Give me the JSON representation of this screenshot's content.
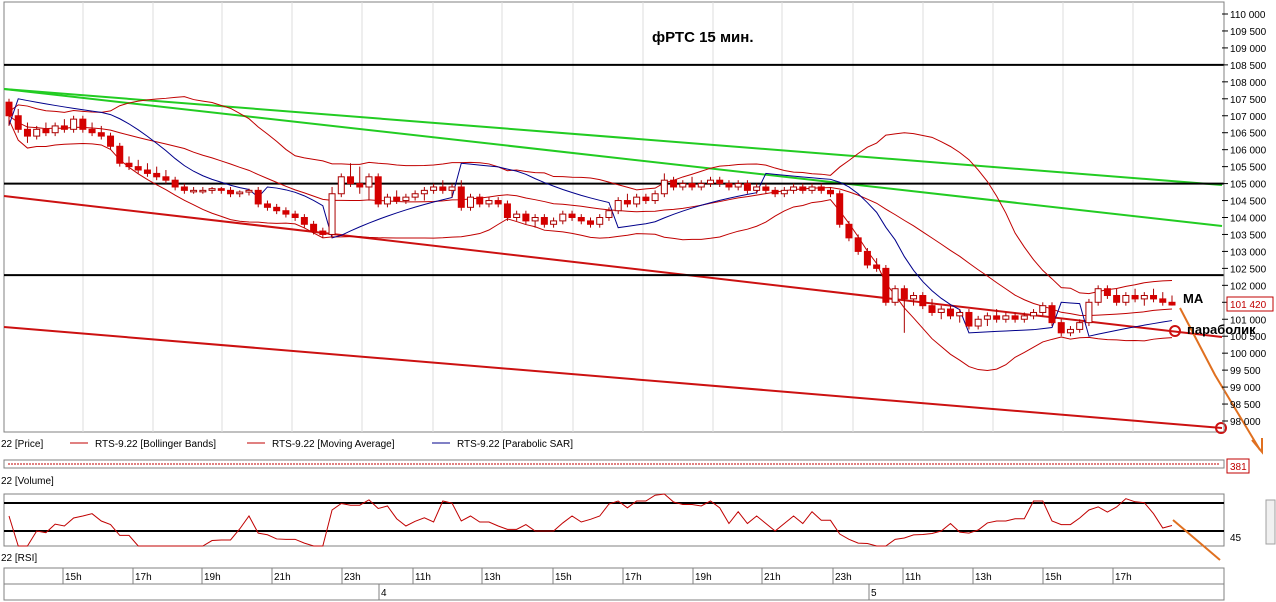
{
  "window": {
    "legend_items": [
      {
        "label": "22 [Price]",
        "color": "#000000"
      },
      {
        "label": "RTS-9.22 [Bollinger Bands]",
        "color": "#c00000"
      },
      {
        "label": "RTS-9.22 [Moving Average]",
        "color": "#c00000"
      },
      {
        "label": "RTS-9.22 [Parabolic SAR]",
        "color": "#00008b"
      }
    ],
    "volume_label": "22 [Volume]",
    "rsi_label": "22 [RSI]",
    "scroll_badge": "381"
  },
  "chart_data": {
    "type": "candlestick",
    "title": "фРТС   15 мин.",
    "price_axis": {
      "ticks": [
        110000,
        109500,
        109000,
        108500,
        108000,
        107500,
        107000,
        106500,
        106000,
        105500,
        105000,
        104500,
        104000,
        103500,
        103000,
        102500,
        102000,
        101500,
        101000,
        100500,
        100000,
        99500,
        99000,
        98500,
        98000
      ],
      "tick_labels": [
        "110 000",
        "109 500",
        "109 000",
        "108 500",
        "108 000",
        "107 500",
        "107 000",
        "106 500",
        "106 000",
        "105 500",
        "105 000",
        "104 500",
        "104 000",
        "103 500",
        "103 000",
        "102 500",
        "102 000",
        "101 500",
        "101 000",
        "100 500",
        "100 000",
        "99 500",
        "99 000",
        "98 500",
        "98 000"
      ],
      "current_price": 101420,
      "current_price_label": "101 420"
    },
    "time_axis": {
      "hour_labels": [
        "15h",
        "17h",
        "19h",
        "21h",
        "23h",
        "11h",
        "13h",
        "15h",
        "17h",
        "19h",
        "21h",
        "23h",
        "11h",
        "13h",
        "15h",
        "17h"
      ],
      "day_labels": [
        "4",
        "5"
      ]
    },
    "horizontal_levels": [
      108500,
      105000,
      102300
    ],
    "annotations": [
      "MA",
      "параболик"
    ],
    "rsi_axis": {
      "tick_label": "45"
    },
    "candles": [
      [
        107400,
        107500,
        106700,
        107000
      ],
      [
        107000,
        107200,
        106500,
        106600
      ],
      [
        106600,
        106800,
        106200,
        106400
      ],
      [
        106400,
        106700,
        106300,
        106600
      ],
      [
        106600,
        106800,
        106400,
        106500
      ],
      [
        106500,
        106800,
        106400,
        106700
      ],
      [
        106700,
        106900,
        106500,
        106600
      ],
      [
        106600,
        107000,
        106500,
        106900
      ],
      [
        106900,
        107000,
        106500,
        106600
      ],
      [
        106600,
        106800,
        106400,
        106500
      ],
      [
        106500,
        106700,
        106300,
        106400
      ],
      [
        106400,
        106500,
        106000,
        106100
      ],
      [
        106100,
        106200,
        105500,
        105600
      ],
      [
        105600,
        105800,
        105400,
        105500
      ],
      [
        105500,
        105700,
        105300,
        105400
      ],
      [
        105400,
        105600,
        105200,
        105300
      ],
      [
        105300,
        105500,
        105100,
        105200
      ],
      [
        105200,
        105400,
        105000,
        105100
      ],
      [
        105100,
        105200,
        104800,
        104900
      ],
      [
        104900,
        105000,
        104700,
        104800
      ],
      [
        104800,
        104900,
        104700,
        104800
      ],
      [
        104800,
        104900,
        104700,
        104800
      ],
      [
        104800,
        104900,
        104700,
        104850
      ],
      [
        104850,
        104900,
        104700,
        104800
      ],
      [
        104800,
        104900,
        104600,
        104700
      ],
      [
        104700,
        104800,
        104600,
        104750
      ],
      [
        104750,
        104850,
        104650,
        104800
      ],
      [
        104800,
        104900,
        104300,
        104400
      ],
      [
        104400,
        104500,
        104200,
        104300
      ],
      [
        104300,
        104400,
        104100,
        104200
      ],
      [
        104200,
        104300,
        104000,
        104100
      ],
      [
        104100,
        104200,
        103900,
        104000
      ],
      [
        104000,
        104100,
        103700,
        103800
      ],
      [
        103800,
        103900,
        103500,
        103600
      ],
      [
        103600,
        103700,
        103400,
        103500
      ],
      [
        103500,
        104900,
        103400,
        104700
      ],
      [
        104700,
        105300,
        104600,
        105200
      ],
      [
        105200,
        105600,
        104900,
        105000
      ],
      [
        105000,
        105500,
        104700,
        104900
      ],
      [
        104900,
        105300,
        104500,
        105200
      ],
      [
        105200,
        105300,
        104300,
        104400
      ],
      [
        104400,
        104700,
        104300,
        104600
      ],
      [
        104600,
        104800,
        104400,
        104500
      ],
      [
        104500,
        104700,
        104400,
        104600
      ],
      [
        104600,
        104800,
        104500,
        104700
      ],
      [
        104700,
        104900,
        104500,
        104800
      ],
      [
        104800,
        105000,
        104700,
        104900
      ],
      [
        104900,
        105100,
        104700,
        104800
      ],
      [
        104800,
        105000,
        104600,
        104900
      ],
      [
        104900,
        105100,
        104200,
        104300
      ],
      [
        104300,
        104700,
        104200,
        104600
      ],
      [
        104600,
        104700,
        104300,
        104400
      ],
      [
        104400,
        104600,
        104300,
        104500
      ],
      [
        104500,
        104600,
        104300,
        104400
      ],
      [
        104400,
        104500,
        103900,
        104000
      ],
      [
        104000,
        104200,
        103900,
        104100
      ],
      [
        104100,
        104200,
        103800,
        103900
      ],
      [
        103900,
        104100,
        103700,
        104000
      ],
      [
        104000,
        104100,
        103700,
        103800
      ],
      [
        103800,
        104000,
        103700,
        103900
      ],
      [
        103900,
        104200,
        103800,
        104100
      ],
      [
        104100,
        104200,
        103900,
        104000
      ],
      [
        104000,
        104100,
        103800,
        103900
      ],
      [
        103900,
        104000,
        103700,
        103800
      ],
      [
        103800,
        104100,
        103700,
        104000
      ],
      [
        104000,
        104300,
        103900,
        104200
      ],
      [
        104200,
        104600,
        104100,
        104500
      ],
      [
        104500,
        104700,
        104300,
        104400
      ],
      [
        104400,
        104700,
        104300,
        104600
      ],
      [
        104600,
        104700,
        104400,
        104500
      ],
      [
        104500,
        104800,
        104400,
        104700
      ],
      [
        104700,
        105300,
        104600,
        105100
      ],
      [
        105100,
        105200,
        104800,
        104900
      ],
      [
        104900,
        105100,
        104800,
        105000
      ],
      [
        105000,
        105200,
        104800,
        104900
      ],
      [
        104900,
        105100,
        104800,
        105000
      ],
      [
        105000,
        105200,
        104900,
        105100
      ],
      [
        105100,
        105200,
        104900,
        105000
      ],
      [
        105000,
        105100,
        104800,
        104900
      ],
      [
        104900,
        105100,
        104800,
        105000
      ],
      [
        105000,
        105100,
        104700,
        104800
      ],
      [
        104800,
        105000,
        104700,
        104900
      ],
      [
        104900,
        105000,
        104700,
        104800
      ],
      [
        104800,
        104900,
        104600,
        104700
      ],
      [
        104700,
        104900,
        104600,
        104800
      ],
      [
        104800,
        105000,
        104700,
        104900
      ],
      [
        104900,
        105000,
        104700,
        104800
      ],
      [
        104800,
        105000,
        104700,
        104900
      ],
      [
        104900,
        105000,
        104700,
        104800
      ],
      [
        104800,
        104900,
        104600,
        104700
      ],
      [
        104700,
        104800,
        103700,
        103800
      ],
      [
        103800,
        103900,
        103300,
        103400
      ],
      [
        103400,
        103500,
        102900,
        103000
      ],
      [
        103000,
        103100,
        102500,
        102600
      ],
      [
        102600,
        102800,
        102400,
        102500
      ],
      [
        102500,
        102600,
        101400,
        101500
      ],
      [
        101500,
        102000,
        101400,
        101900
      ],
      [
        101900,
        102000,
        100600,
        101600
      ],
      [
        101600,
        101800,
        101400,
        101700
      ],
      [
        101700,
        101800,
        101300,
        101400
      ],
      [
        101400,
        101600,
        101100,
        101200
      ],
      [
        101200,
        101400,
        101000,
        101300
      ],
      [
        101300,
        101400,
        101000,
        101100
      ],
      [
        101100,
        101300,
        100900,
        101200
      ],
      [
        101200,
        101300,
        100700,
        100800
      ],
      [
        100800,
        101100,
        100700,
        101000
      ],
      [
        101000,
        101200,
        100800,
        101100
      ],
      [
        101100,
        101300,
        100900,
        101000
      ],
      [
        101000,
        101200,
        100900,
        101100
      ],
      [
        101100,
        101200,
        100900,
        101000
      ],
      [
        101000,
        101200,
        100900,
        101100
      ],
      [
        101100,
        101300,
        101000,
        101200
      ],
      [
        101200,
        101500,
        101100,
        101400
      ],
      [
        101400,
        101500,
        100800,
        100900
      ],
      [
        100900,
        101000,
        100500,
        100600
      ],
      [
        100600,
        100800,
        100500,
        100700
      ],
      [
        100700,
        101000,
        100600,
        100900
      ],
      [
        100900,
        101600,
        100800,
        101500
      ],
      [
        101500,
        102000,
        101400,
        101900
      ],
      [
        101900,
        102000,
        101600,
        101700
      ],
      [
        101700,
        101900,
        101400,
        101500
      ],
      [
        101500,
        101800,
        101400,
        101700
      ],
      [
        101700,
        101900,
        101500,
        101600
      ],
      [
        101600,
        101800,
        101400,
        101700
      ],
      [
        101700,
        101900,
        101500,
        101600
      ],
      [
        101600,
        101800,
        101400,
        101500
      ],
      [
        101500,
        101700,
        101400,
        101420
      ]
    ]
  }
}
